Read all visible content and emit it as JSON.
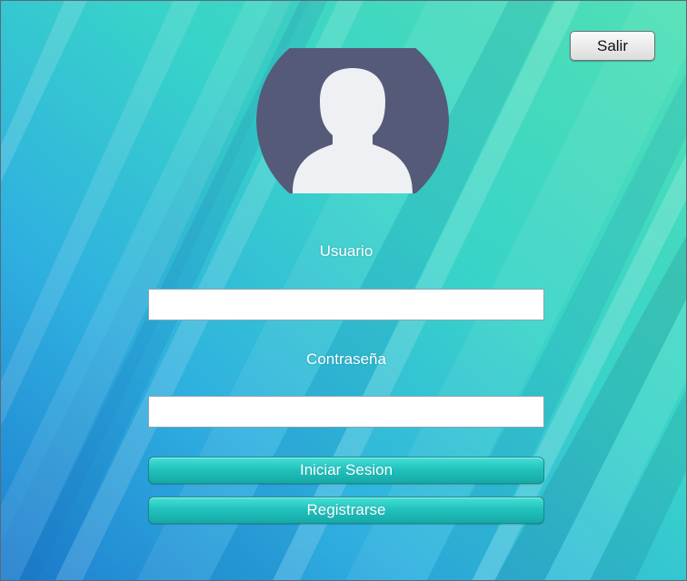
{
  "window": {
    "exit_label": "Salir"
  },
  "login": {
    "avatar_icon": "user-avatar-icon",
    "username_label": "Usuario",
    "username_value": "",
    "password_label": "Contraseña",
    "password_value": "",
    "login_button_label": "Iniciar Sesion",
    "register_button_label": "Registrarse"
  },
  "colors": {
    "avatar_circle": "#555a78",
    "avatar_silhouette": "#eef0f3",
    "button_teal": "#22c2bd",
    "background_blue": "#33b5d6",
    "background_green": "#5fe3bf"
  }
}
